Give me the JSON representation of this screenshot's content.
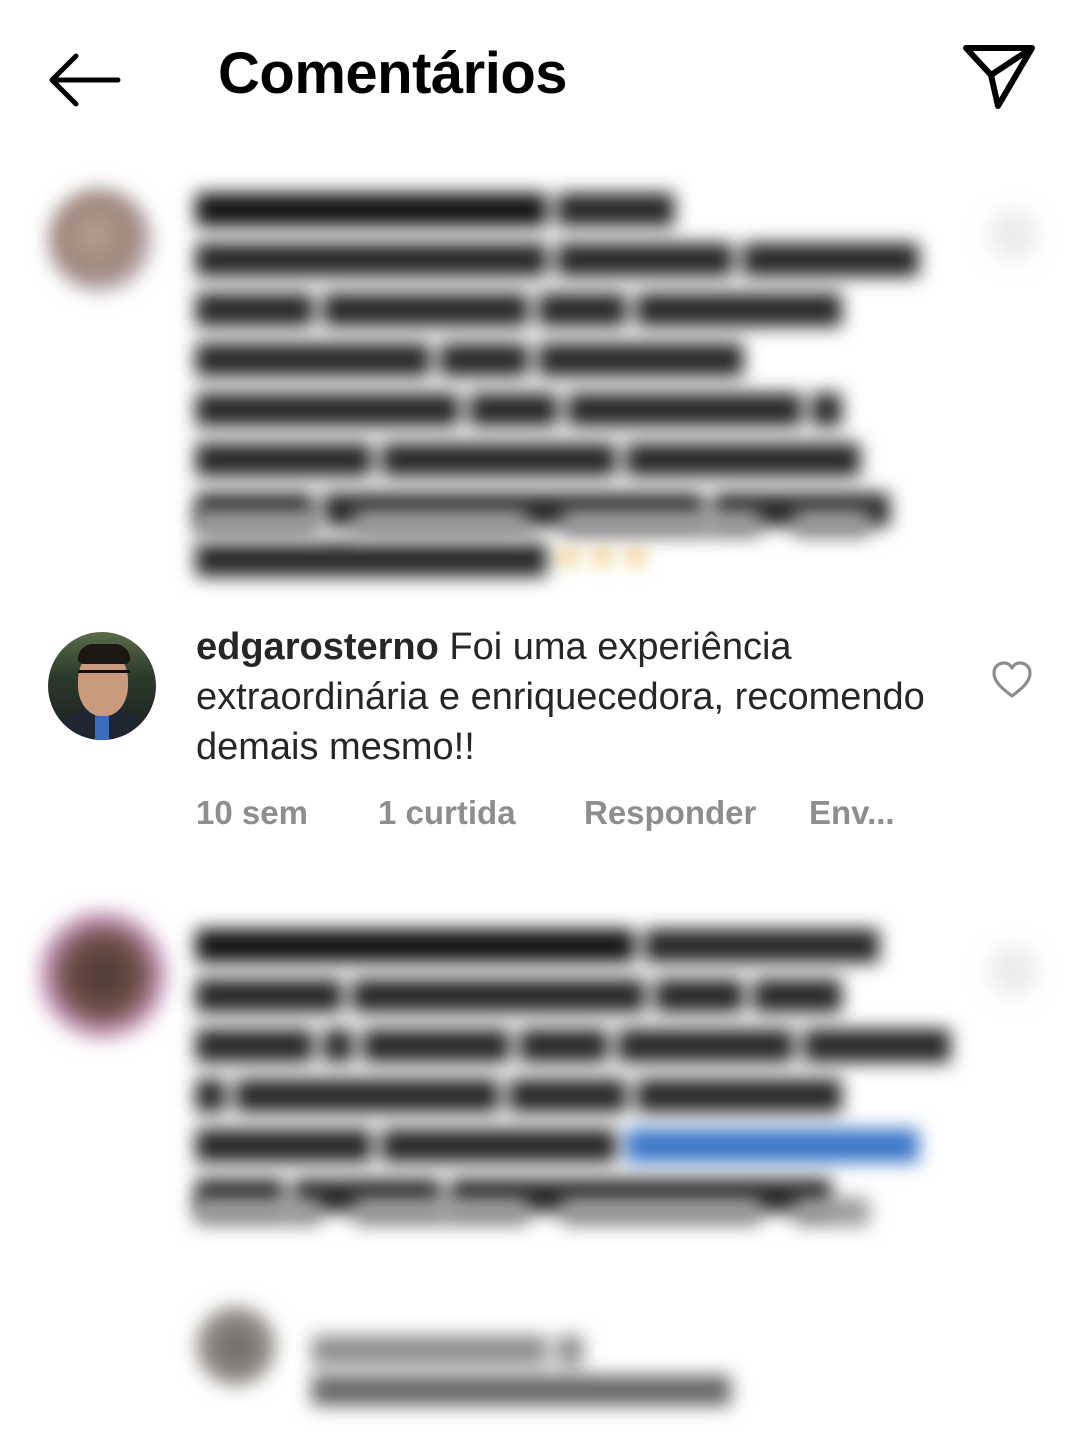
{
  "header": {
    "title": "Comentários"
  },
  "comment": {
    "username": "edgarosterno",
    "text": "Foi uma experiência extraordinária e enriquecedora, recomendo demais mesmo!!",
    "time": "10 sem",
    "likes": "1 curtida",
    "reply": "Responder",
    "send": "Env..."
  }
}
